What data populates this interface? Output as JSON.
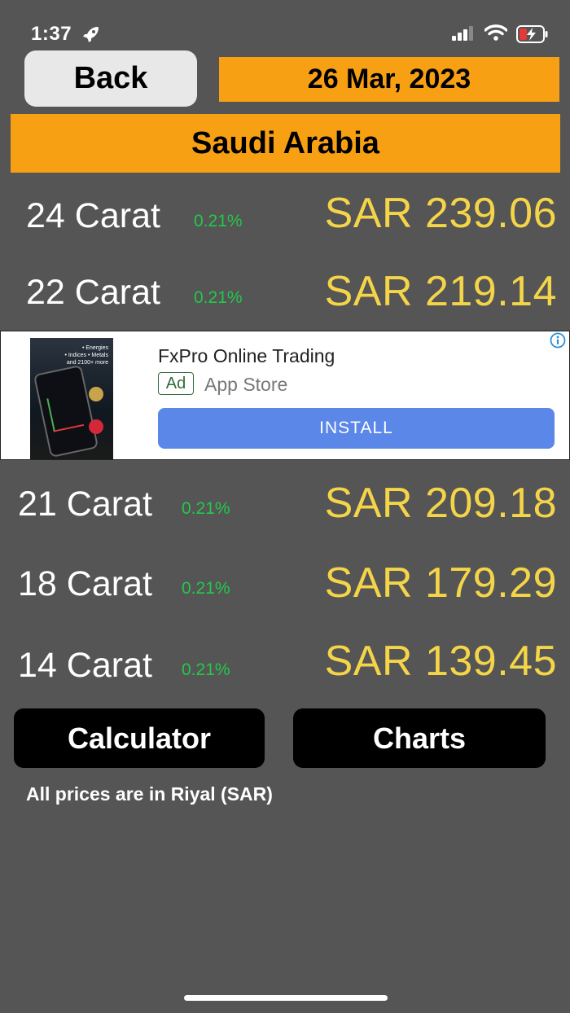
{
  "status_bar": {
    "time": "1:37"
  },
  "header": {
    "back_label": "Back",
    "date": "26 Mar, 2023",
    "country": "Saudi Arabia"
  },
  "prices_top": [
    {
      "carat": "24 Carat",
      "change": "0.21%",
      "price": "SAR 239.06"
    },
    {
      "carat": "22 Carat",
      "change": "0.21%",
      "price": "SAR 219.14"
    }
  ],
  "ad": {
    "title": "FxPro Online Trading",
    "badge": "Ad",
    "store": "App Store",
    "install_label": "INSTALL",
    "image_caption": "• Energies\n• Indices • Metals\nand 2100+ more"
  },
  "prices_bottom": [
    {
      "carat": "21 Carat",
      "change": "0.21%",
      "price": "SAR 209.18"
    },
    {
      "carat": "18 Carat",
      "change": "0.21%",
      "price": "SAR 179.29"
    },
    {
      "carat": "14 Carat",
      "change": "0.21%",
      "price": "SAR 139.45"
    }
  ],
  "actions": {
    "calculator_label": "Calculator",
    "charts_label": "Charts"
  },
  "footer_note": "All prices are in Riyal (SAR)",
  "colors": {
    "accent": "#f7a014",
    "price": "#f5d548",
    "change": "#22c94a",
    "background": "#555555",
    "install": "#5b87e8"
  }
}
